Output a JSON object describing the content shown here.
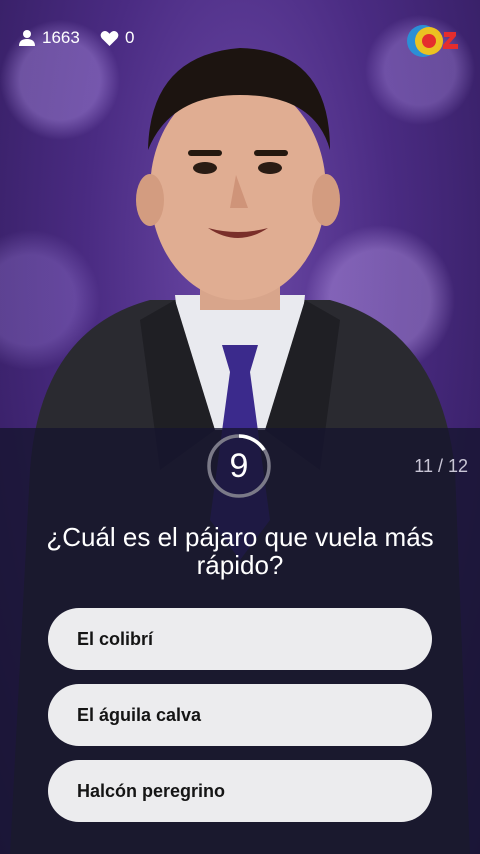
{
  "header": {
    "viewer_count": "1663",
    "like_count": "0",
    "icons": {
      "viewers": "person-icon",
      "likes": "heart-icon",
      "logo": "q12-logo"
    }
  },
  "quiz": {
    "timer_value": "9",
    "progress": "11 / 12",
    "question": "¿Cuál es el pájaro que vuela más rápido?",
    "answers": [
      "El colibrí",
      "El águila calva",
      "Halcón peregrino"
    ]
  },
  "colors": {
    "background_purple": "#4a2b82",
    "overlay": "#16142e",
    "answer_bg": "#ececee",
    "logo_blue": "#2b8fd6",
    "logo_yellow": "#f5c518",
    "logo_red": "#e52d2d"
  }
}
